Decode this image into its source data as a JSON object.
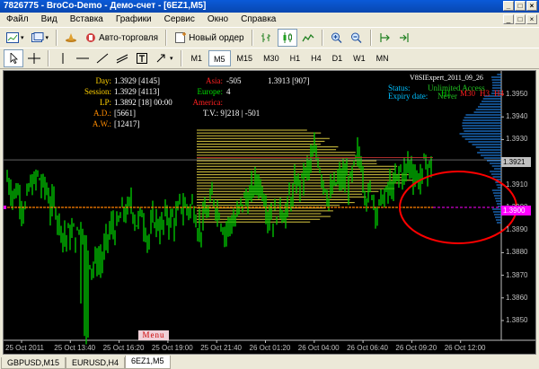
{
  "window": {
    "title": "7826775 - BroCo-Demo - Демо-счет - [6EZ1,M5]"
  },
  "menu": [
    "Файл",
    "Вид",
    "Вставка",
    "Графики",
    "Сервис",
    "Окно",
    "Справка"
  ],
  "toolbar1": {
    "autotrade_label": "Авто-торговля",
    "new_order_label": "Новый ордер"
  },
  "timeframes": [
    "M1",
    "M5",
    "M15",
    "M30",
    "H1",
    "H4",
    "D1",
    "W1",
    "MN"
  ],
  "active_timeframe": "M5",
  "chart": {
    "info_left": [
      {
        "label": "Day:",
        "value": "1.3929 [4145]"
      },
      {
        "label": "Session:",
        "value": "1.3929 [4113]"
      },
      {
        "label": "LP:",
        "value": "1.3892 [18] 00:00"
      },
      {
        "label": "A.D.:",
        "value": "[5661]"
      },
      {
        "label": "A.W.:",
        "value": "[12417]"
      }
    ],
    "sessions": [
      {
        "label": "Asia:",
        "value": "-505",
        "value2": "1.3913 [907]"
      },
      {
        "label": "Europe:",
        "value": "4"
      },
      {
        "label": "America:",
        "value": ""
      }
    ],
    "t_v": "T.V.: 9]218 | -501",
    "expert_name": "V8SIExpert_2011_09_26",
    "status_label": "Status:",
    "status_value": "Unlimited Access",
    "expiry_label": "Expiry date:",
    "expiry_value": "Never",
    "tf_marks": [
      "H1",
      "M30",
      "H3",
      "H4"
    ],
    "current_price": "1.3921",
    "marked_price": "1.3900",
    "price_axis": [
      "1.3950",
      "1.3940",
      "1.3930",
      "1.3920",
      "1.3910",
      "1.3900",
      "1.3890",
      "1.3880",
      "1.3870",
      "1.3860",
      "1.3850"
    ],
    "time_axis": [
      "25 Oct 2011",
      "25 Oct 13:40",
      "25 Oct 16:20",
      "25 Oct 19:00",
      "25 Oct 21:40",
      "26 Oct 01:20",
      "26 Oct 04:00",
      "26 Oct 06:40",
      "26 Oct 09:20",
      "26 Oct 12:00"
    ],
    "menu_button": "Menu"
  },
  "tabs": [
    "GBPUSD,M15",
    "EURUSD,H4",
    "6EZ1,M5"
  ],
  "active_tab": "6EZ1,M5",
  "colors": {
    "candles": "#00c000",
    "profile_yellow": "#d8c840",
    "profile_blue": "#1e7ad8",
    "orange_line": "#ff8000",
    "circle": "#ff0000",
    "label_day": "#ffd000",
    "label_ad": "#ff8c00",
    "label_asia": "#ff2020",
    "label_europe": "#00e000",
    "status_cyan": "#00c0ff",
    "magenta": "#ff00ff"
  }
}
